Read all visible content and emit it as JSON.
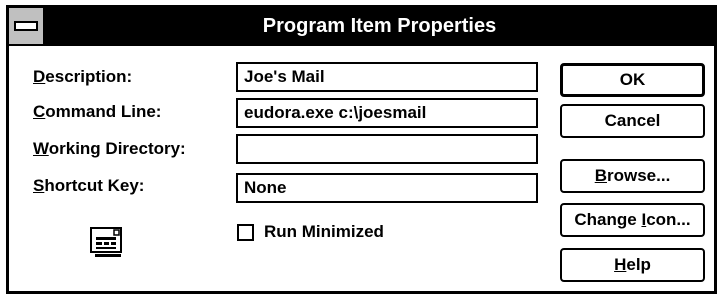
{
  "window": {
    "title": "Program Item Properties"
  },
  "fields": {
    "description": {
      "label_ul": "D",
      "label_rest": "escription:",
      "value": "Joe's Mail"
    },
    "command_line": {
      "label_ul": "C",
      "label_rest": "ommand Line:",
      "value": "eudora.exe c:\\joesmail"
    },
    "working_directory": {
      "label_ul": "W",
      "label_rest": "orking Directory:",
      "value": ""
    },
    "shortcut_key": {
      "label_ul": "S",
      "label_rest": "hortcut Key:",
      "value": "None"
    }
  },
  "checkbox": {
    "run_minimized": {
      "label_ul": "R",
      "label_rest": "un Minimized",
      "checked": false
    }
  },
  "buttons": {
    "ok": "OK",
    "cancel": "Cancel",
    "browse_ul": "B",
    "browse_rest": "rowse...",
    "change_icon_pre": "Change ",
    "change_icon_ul": "I",
    "change_icon_rest": "con...",
    "help_ul": "H",
    "help_rest": "elp"
  },
  "icons": {
    "system_menu": "system-menu-icon",
    "program": "program-icon"
  }
}
